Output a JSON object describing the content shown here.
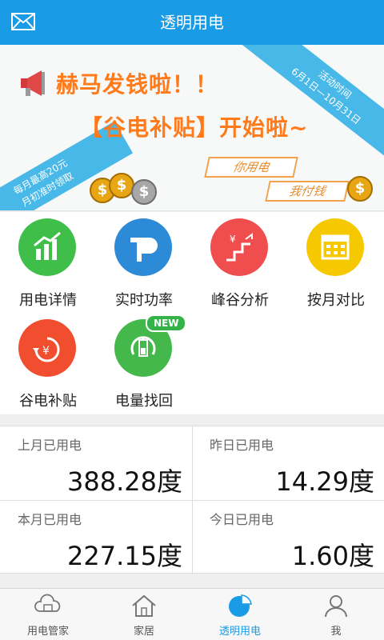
{
  "header": {
    "title": "透明用电"
  },
  "banner": {
    "headline1": "赫马发钱啦！！",
    "headline2": "【谷电补贴】开始啦~",
    "ribbon_top_line1": "活动时间",
    "ribbon_top_line2": "6月1日—10月31日",
    "ribbon_bottom_line1": "每月最高20元",
    "ribbon_bottom_line2": "月初准时领取",
    "pay1": "你用电",
    "pay2": "我付钱"
  },
  "features": [
    {
      "label": "用电详情",
      "icon": "bar-chart-icon",
      "color": "#3fbf4a"
    },
    {
      "label": "实时功率",
      "icon": "p-logo-icon",
      "color": "#2c8ad6"
    },
    {
      "label": "峰谷分析",
      "icon": "peak-valley-icon",
      "color": "#f04e4e"
    },
    {
      "label": "按月对比",
      "icon": "calendar-icon",
      "color": "#f5c800"
    },
    {
      "label": "谷电补贴",
      "icon": "yen-refresh-icon",
      "color": "#f04e2e"
    },
    {
      "label": "电量找回",
      "icon": "battery-refresh-icon",
      "color": "#44b84a",
      "badge": "NEW"
    }
  ],
  "stats": {
    "last_month": {
      "label": "上月已用电",
      "value": "388.28度"
    },
    "yesterday": {
      "label": "昨日已用电",
      "value": "14.29度"
    },
    "this_month": {
      "label": "本月已用电",
      "value": "227.15度"
    },
    "today": {
      "label": "今日已用电",
      "value": "1.60度"
    }
  },
  "bottom_nav": [
    {
      "label": "用电管家",
      "icon": "cloud-house-icon"
    },
    {
      "label": "家居",
      "icon": "home-icon"
    },
    {
      "label": "透明用电",
      "icon": "pie-icon",
      "active": true
    },
    {
      "label": "我",
      "icon": "user-icon"
    }
  ],
  "colors": {
    "primary": "#1a9be6",
    "orange": "#ff7a1a"
  }
}
